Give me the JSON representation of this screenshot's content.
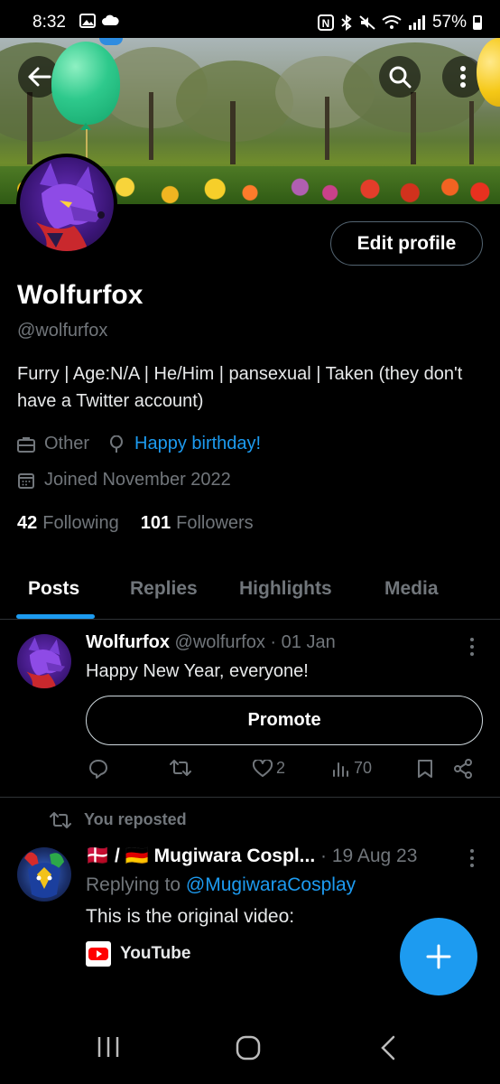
{
  "status_bar": {
    "time": "8:32",
    "battery": "57%"
  },
  "profile": {
    "name": "Wolfurfox",
    "handle": "@wolfurfox",
    "bio": "Furry | Age:N/A | He/Him | pansexual | Taken (they don't have a Twitter account)",
    "category": "Other",
    "birthday": "Happy birthday!",
    "joined": "Joined November 2022",
    "following_count": "42",
    "following_label": "Following",
    "followers_count": "101",
    "followers_label": "Followers",
    "edit_button": "Edit profile"
  },
  "tabs": [
    {
      "label": "Posts",
      "active": true
    },
    {
      "label": "Replies",
      "active": false
    },
    {
      "label": "Highlights",
      "active": false
    },
    {
      "label": "Media",
      "active": false
    }
  ],
  "tweet1": {
    "name": "Wolfurfox",
    "handle": "@wolfurfox",
    "date": "· 01 Jan",
    "text": "Happy New Year, everyone!",
    "promote": "Promote",
    "likes": "2",
    "views": "70"
  },
  "tweet2": {
    "repost_label": "You reposted",
    "name": "🇩🇰 / 🇩🇪 Mugiwara Cospl...",
    "date": "· 19 Aug 23",
    "replying_prefix": "Replying to",
    "replying_to": "@MugiwaraCosplay",
    "text": "This is the original video:",
    "embed": "YouTube"
  },
  "colors": {
    "accent": "#1d9bf0",
    "background": "#000000",
    "muted": "#71767b"
  }
}
